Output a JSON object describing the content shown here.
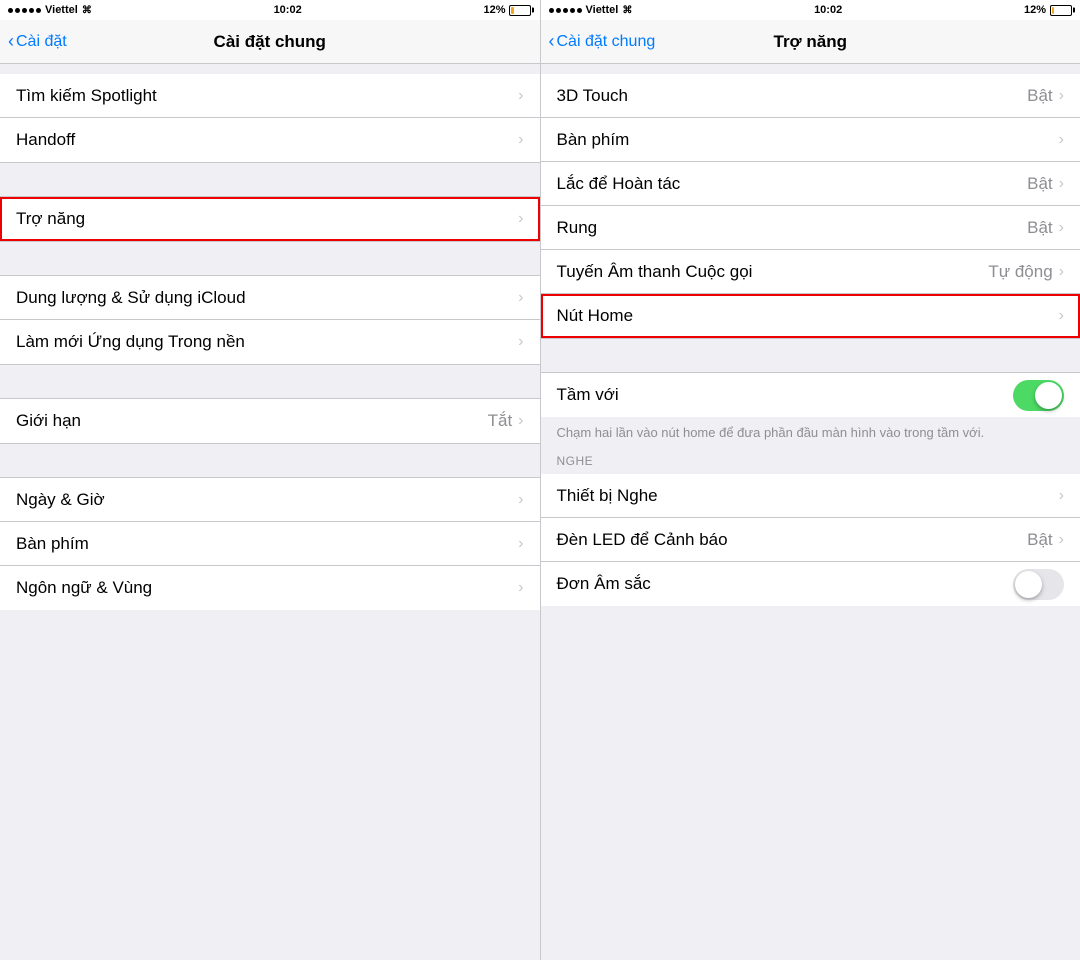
{
  "left_panel": {
    "status_bar": {
      "carrier": "Viettel",
      "time": "10:02",
      "battery_pct": "12%"
    },
    "nav": {
      "back_label": "Cài đặt",
      "title": "Cài đặt chung"
    },
    "groups": [
      {
        "id": "group1",
        "rows": [
          {
            "id": "spotlight",
            "label": "Tìm kiếm Spotlight",
            "value": "",
            "chevron": true
          },
          {
            "id": "handoff",
            "label": "Handoff",
            "value": "",
            "chevron": true
          }
        ]
      },
      {
        "id": "group2",
        "rows": [
          {
            "id": "tro-nang",
            "label": "Trợ năng",
            "value": "",
            "chevron": true,
            "highlighted": true
          }
        ]
      },
      {
        "id": "group3",
        "rows": [
          {
            "id": "icloud",
            "label": "Dung lượng & Sử dụng iCloud",
            "value": "",
            "chevron": true
          },
          {
            "id": "lam-moi",
            "label": "Làm mới Ứng dụng Trong nền",
            "value": "",
            "chevron": true
          }
        ]
      },
      {
        "id": "group4",
        "rows": [
          {
            "id": "gioi-han",
            "label": "Giới hạn",
            "value": "Tắt",
            "chevron": true
          }
        ]
      },
      {
        "id": "group5",
        "rows": [
          {
            "id": "ngay-gio",
            "label": "Ngày & Giờ",
            "value": "",
            "chevron": true
          },
          {
            "id": "ban-phim",
            "label": "Bàn phím",
            "value": "",
            "chevron": true
          },
          {
            "id": "ngon-ngu",
            "label": "Ngôn ngữ & Vùng",
            "value": "",
            "chevron": true
          }
        ]
      }
    ]
  },
  "right_panel": {
    "status_bar": {
      "carrier": "Viettel",
      "time": "10:02",
      "battery_pct": "12%"
    },
    "nav": {
      "back_label": "Cài đặt chung",
      "title": "Trợ năng"
    },
    "groups": [
      {
        "id": "rg1",
        "rows": [
          {
            "id": "3d-touch",
            "label": "3D Touch",
            "value": "Bật",
            "chevron": true
          },
          {
            "id": "ban-phim",
            "label": "Bàn phím",
            "value": "",
            "chevron": true
          },
          {
            "id": "lac-de",
            "label": "Lắc để Hoàn tác",
            "value": "Bật",
            "chevron": true
          },
          {
            "id": "rung",
            "label": "Rung",
            "value": "Bật",
            "chevron": true
          },
          {
            "id": "tuyen-am",
            "label": "Tuyến Âm thanh Cuộc gọi",
            "value": "Tự động",
            "chevron": true
          },
          {
            "id": "nut-home",
            "label": "Nút Home",
            "value": "",
            "chevron": true,
            "highlighted": true
          }
        ]
      },
      {
        "id": "rg2",
        "rows": [
          {
            "id": "tam-voi",
            "label": "Tầm với",
            "value": "",
            "toggle": true,
            "toggle_on": true
          }
        ]
      },
      {
        "helper": "Chạm hai lần vào nút home để đưa phần đầu màn hình vào trong tầm với."
      },
      {
        "section_header": "NGHE"
      },
      {
        "id": "rg3",
        "rows": [
          {
            "id": "thiet-bi-nghe",
            "label": "Thiết bị Nghe",
            "value": "",
            "chevron": true
          },
          {
            "id": "den-led",
            "label": "Đèn LED để Cảnh báo",
            "value": "Bật",
            "chevron": true
          },
          {
            "id": "don-am-sac",
            "label": "Đơn Âm sắc",
            "value": "",
            "toggle": true,
            "toggle_on": false
          }
        ]
      }
    ]
  }
}
